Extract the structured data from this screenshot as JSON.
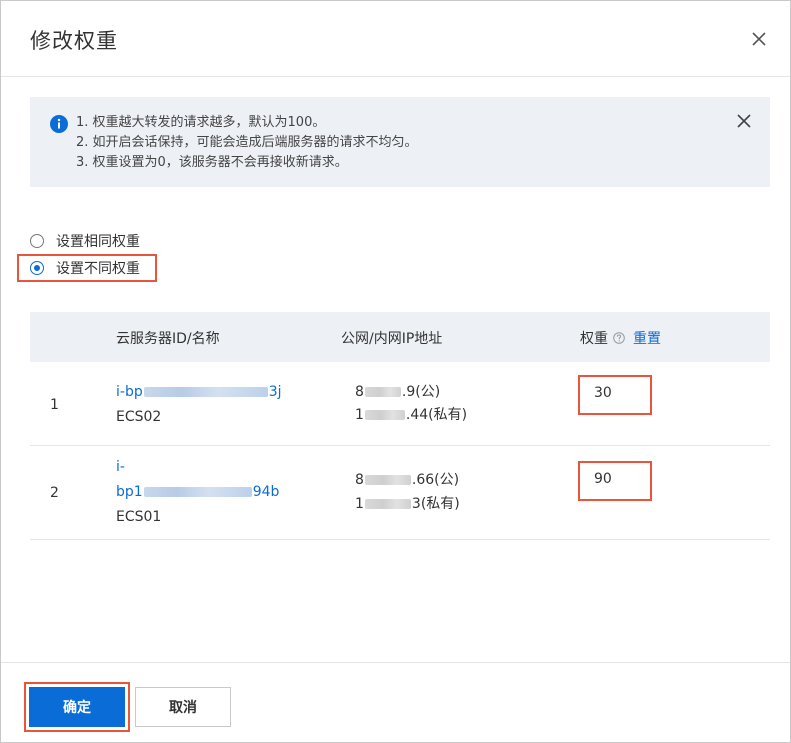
{
  "dialog": {
    "title": "修改权重"
  },
  "notice": {
    "lines": [
      "1. 权重越大转发的请求越多，默认为100。",
      "2. 如开启会话保持，可能会造成后端服务器的请求不均匀。",
      "3. 权重设置为0，该服务器不会再接收新请求。"
    ]
  },
  "weight_mode": {
    "options": [
      "设置相同权重",
      "设置不同权重"
    ],
    "selected": "设置不同权重"
  },
  "table": {
    "headers": {
      "id_name": "云服务器ID/名称",
      "ip": "公网/内网IP地址",
      "weight": "权重",
      "reset": "重置"
    },
    "rows": [
      {
        "index": "1",
        "id_prefix": "i-bp",
        "id_suffix": "3j",
        "name": "ECS02",
        "public_ip_prefix": "8",
        "public_ip_suffix": ".9(公)",
        "private_ip_prefix": "1",
        "private_ip_suffix": ".44(私有)",
        "weight": "30"
      },
      {
        "index": "2",
        "id_line1": "i-",
        "id_prefix": "bp1",
        "id_suffix": "94b",
        "name": "ECS01",
        "public_ip_prefix": "8",
        "public_ip_suffix": ".66(公)",
        "private_ip_prefix": "1",
        "private_ip_suffix": "3(私有)",
        "weight": "90"
      }
    ]
  },
  "footer": {
    "confirm_label": "确定",
    "cancel_label": "取消"
  },
  "colors": {
    "accent": "#0a6cd6",
    "highlight": "#e8553a",
    "notice_bg": "#edf0f5"
  }
}
